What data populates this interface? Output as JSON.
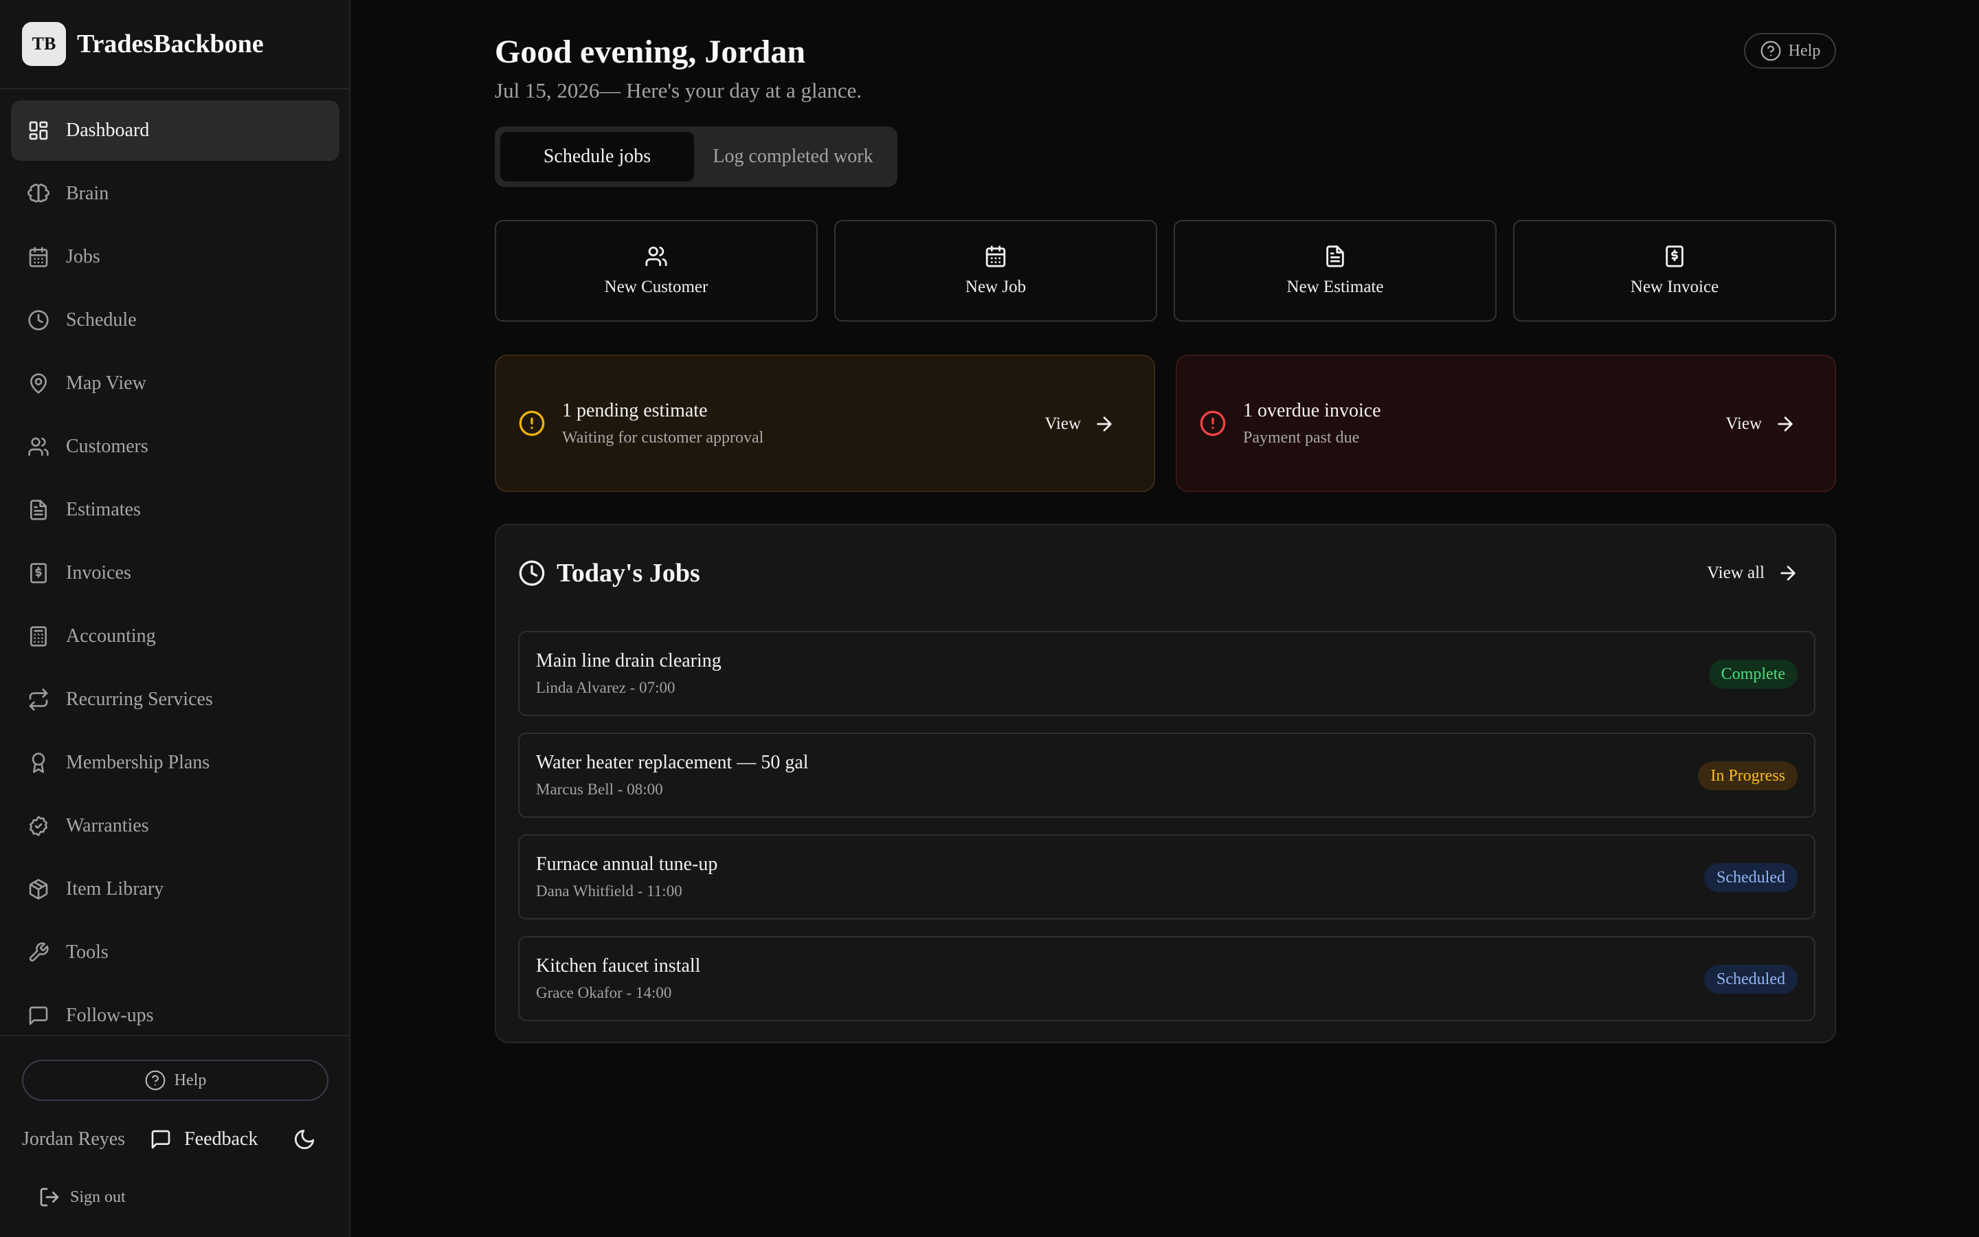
{
  "brand": {
    "logo": "TB",
    "name": "TradesBackbone"
  },
  "nav": [
    {
      "label": "Dashboard",
      "icon": "dashboard-icon",
      "active": true
    },
    {
      "label": "Brain",
      "icon": "brain-icon"
    },
    {
      "label": "Jobs",
      "icon": "calendar-icon"
    },
    {
      "label": "Schedule",
      "icon": "clock-icon"
    },
    {
      "label": "Map View",
      "icon": "map-pin-icon"
    },
    {
      "label": "Customers",
      "icon": "users-icon"
    },
    {
      "label": "Estimates",
      "icon": "file-text-icon"
    },
    {
      "label": "Invoices",
      "icon": "receipt-icon"
    },
    {
      "label": "Accounting",
      "icon": "calculator-icon"
    },
    {
      "label": "Recurring Services",
      "icon": "repeat-icon"
    },
    {
      "label": "Membership Plans",
      "icon": "award-icon"
    },
    {
      "label": "Warranties",
      "icon": "badge-check-icon"
    },
    {
      "label": "Item Library",
      "icon": "package-icon"
    },
    {
      "label": "Tools",
      "icon": "wrench-icon"
    },
    {
      "label": "Follow-ups",
      "icon": "message-icon"
    }
  ],
  "sidebar_footer": {
    "help_label": "Help",
    "user_name": "Jordan Reyes",
    "feedback_label": "Feedback",
    "signout_label": "Sign out"
  },
  "header": {
    "greeting": "Good evening, Jordan",
    "subline": "Jul 15, 2026— Here's your day at a glance.",
    "help_label": "Help"
  },
  "tabs": [
    {
      "label": "Schedule jobs",
      "active": true
    },
    {
      "label": "Log completed work",
      "active": false
    }
  ],
  "quick_actions": [
    {
      "label": "New Customer",
      "icon": "users-icon"
    },
    {
      "label": "New Job",
      "icon": "calendar-icon"
    },
    {
      "label": "New Estimate",
      "icon": "file-text-icon"
    },
    {
      "label": "New Invoice",
      "icon": "receipt-icon"
    }
  ],
  "alerts": [
    {
      "title": "1 pending estimate",
      "subtitle": "Waiting for customer approval",
      "action": "View",
      "color": "#eab308"
    },
    {
      "title": "1 overdue invoice",
      "subtitle": "Payment past due",
      "action": "View",
      "color": "#ef4444"
    }
  ],
  "todays_jobs": {
    "title": "Today's Jobs",
    "view_all": "View all",
    "jobs": [
      {
        "title": "Main line drain clearing",
        "meta": "Linda Alvarez - 07:00",
        "status": "Complete"
      },
      {
        "title": "Water heater replacement — 50 gal",
        "meta": "Marcus Bell - 08:00",
        "status": "In Progress"
      },
      {
        "title": "Furnace annual tune-up",
        "meta": "Dana Whitfield - 11:00",
        "status": "Scheduled"
      },
      {
        "title": "Kitchen faucet install",
        "meta": "Grace Okafor - 14:00",
        "status": "Scheduled"
      }
    ]
  },
  "colors": {
    "complete": "#4ade80",
    "in_progress": "#fbbf24",
    "scheduled": "#93b4f5"
  }
}
